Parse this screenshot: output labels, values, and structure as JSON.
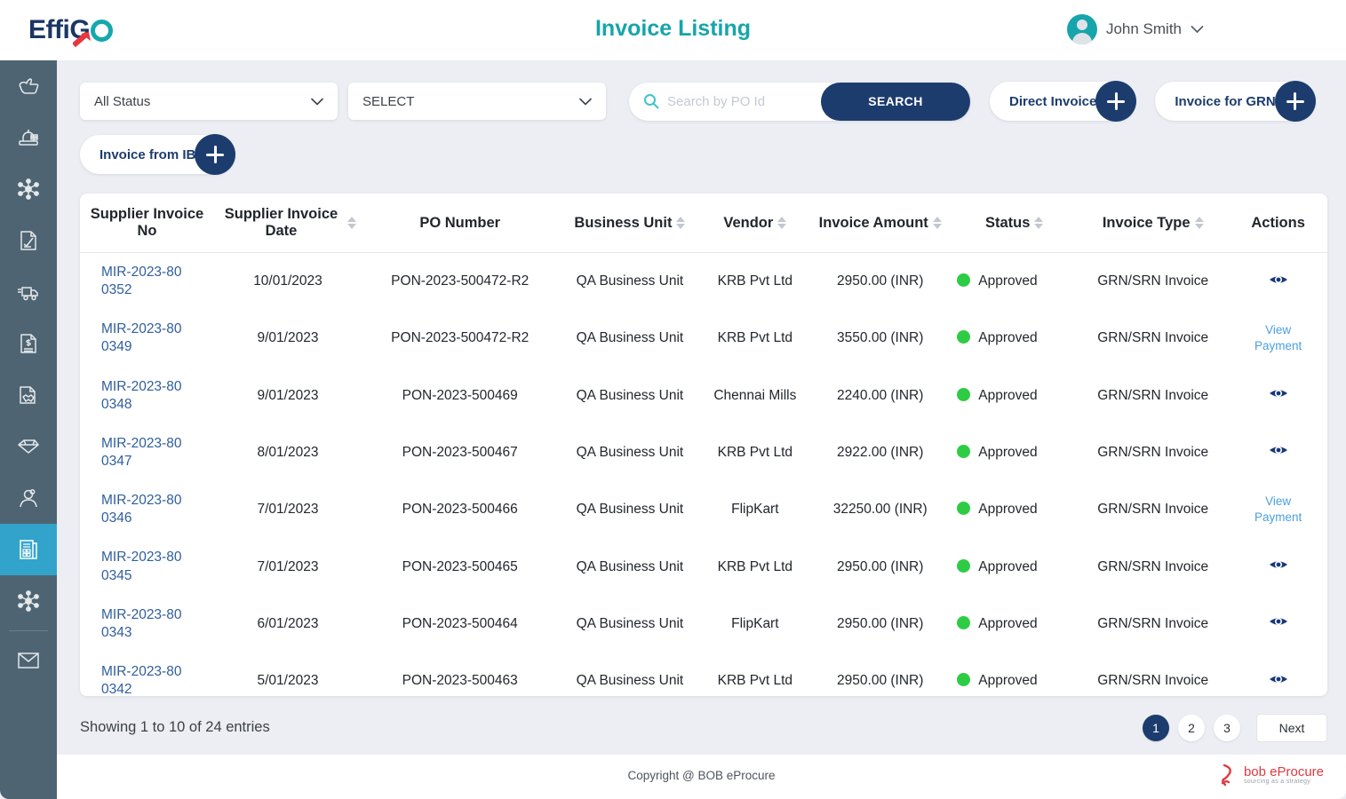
{
  "brand": {
    "logo_text_1": "Effi",
    "logo_text_2": "G",
    "accent_teal": "#16a5ab",
    "accent_navy": "#1d3c6e",
    "accent_red": "#e8363f"
  },
  "header": {
    "title": "Invoice Listing",
    "user_name": "John Smith",
    "caret_icon": "chevron-down-icon",
    "avatar_icon": "user-avatar"
  },
  "sidebar": {
    "items": [
      {
        "icon": "thumbs-up-icon",
        "active": false
      },
      {
        "icon": "auction-gavel-icon",
        "active": false
      },
      {
        "icon": "network-nodes-icon",
        "active": false
      },
      {
        "icon": "document-edit-icon",
        "active": false
      },
      {
        "icon": "delivery-truck-icon",
        "active": false
      },
      {
        "icon": "invoice-dollar-icon",
        "active": false
      },
      {
        "icon": "contract-handshake-icon",
        "active": false
      },
      {
        "icon": "diamond-gem-icon",
        "active": false
      },
      {
        "icon": "user-badge-icon",
        "active": false
      },
      {
        "icon": "invoice-listing-icon",
        "active": true
      },
      {
        "icon": "network-nodes-icon",
        "active": false
      },
      {
        "icon": "envelope-mail-icon",
        "active": false
      }
    ]
  },
  "filters": {
    "status_select": {
      "value": "All Status",
      "icon": "chevron-down-icon"
    },
    "type_select": {
      "value": "SELECT",
      "icon": "chevron-down-icon"
    },
    "search": {
      "placeholder": "Search by PO Id",
      "value": "",
      "icon": "search-icon",
      "button_label": "SEARCH"
    },
    "actions": [
      {
        "label": "Direct Invoice",
        "icon": "plus-icon"
      },
      {
        "label": "Invoice for GRN",
        "icon": "plus-icon"
      },
      {
        "label": "Invoice from IB",
        "icon": "plus-icon"
      }
    ]
  },
  "table": {
    "columns": [
      {
        "label": "Supplier Invoice No",
        "sortable": false
      },
      {
        "label": "Supplier Invoice Date",
        "sortable": true
      },
      {
        "label": "PO Number",
        "sortable": false
      },
      {
        "label": "Business Unit",
        "sortable": true
      },
      {
        "label": "Vendor",
        "sortable": true
      },
      {
        "label": "Invoice Amount",
        "sortable": true
      },
      {
        "label": "Status",
        "sortable": true
      },
      {
        "label": "Invoice Type",
        "sortable": true
      },
      {
        "label": "Actions",
        "sortable": false
      }
    ],
    "rows": [
      {
        "invoice_no": "MIR-2023-800352",
        "date": "10/01/2023",
        "po_number": "PON-2023-500472-R2",
        "business_unit": "QA Business Unit",
        "vendor": "KRB Pvt Ltd",
        "amount": "2950.00 (INR)",
        "status": "Approved",
        "status_color": "#2ecc45",
        "invoice_type": "GRN/SRN Invoice",
        "action": "eye",
        "action_label": ""
      },
      {
        "invoice_no": "MIR-2023-800349",
        "date": "9/01/2023",
        "po_number": "PON-2023-500472-R2",
        "business_unit": "QA Business Unit",
        "vendor": "KRB Pvt Ltd",
        "amount": "3550.00 (INR)",
        "status": "Approved",
        "status_color": "#2ecc45",
        "invoice_type": "GRN/SRN Invoice",
        "action": "link",
        "action_label": "View Payment"
      },
      {
        "invoice_no": "MIR-2023-800348",
        "date": "9/01/2023",
        "po_number": "PON-2023-500469",
        "business_unit": "QA Business Unit",
        "vendor": "Chennai Mills",
        "amount": "2240.00 (INR)",
        "status": "Approved",
        "status_color": "#2ecc45",
        "invoice_type": "GRN/SRN Invoice",
        "action": "eye",
        "action_label": ""
      },
      {
        "invoice_no": "MIR-2023-800347",
        "date": "8/01/2023",
        "po_number": "PON-2023-500467",
        "business_unit": "QA Business Unit",
        "vendor": "KRB Pvt Ltd",
        "amount": "2922.00 (INR)",
        "status": "Approved",
        "status_color": "#2ecc45",
        "invoice_type": "GRN/SRN Invoice",
        "action": "eye",
        "action_label": ""
      },
      {
        "invoice_no": "MIR-2023-800346",
        "date": "7/01/2023",
        "po_number": "PON-2023-500466",
        "business_unit": "QA Business Unit",
        "vendor": "FlipKart",
        "amount": "32250.00 (INR)",
        "status": "Approved",
        "status_color": "#2ecc45",
        "invoice_type": "GRN/SRN Invoice",
        "action": "link",
        "action_label": "View Payment"
      },
      {
        "invoice_no": "MIR-2023-800345",
        "date": "7/01/2023",
        "po_number": "PON-2023-500465",
        "business_unit": "QA Business Unit",
        "vendor": "KRB Pvt Ltd",
        "amount": "2950.00 (INR)",
        "status": "Approved",
        "status_color": "#2ecc45",
        "invoice_type": "GRN/SRN Invoice",
        "action": "eye",
        "action_label": ""
      },
      {
        "invoice_no": "MIR-2023-800343",
        "date": "6/01/2023",
        "po_number": "PON-2023-500464",
        "business_unit": "QA Business Unit",
        "vendor": "FlipKart",
        "amount": "2950.00 (INR)",
        "status": "Approved",
        "status_color": "#2ecc45",
        "invoice_type": "GRN/SRN Invoice",
        "action": "eye",
        "action_label": ""
      },
      {
        "invoice_no": "MIR-2023-800342",
        "date": "5/01/2023",
        "po_number": "PON-2023-500463",
        "business_unit": "QA Business Unit",
        "vendor": "KRB Pvt Ltd",
        "amount": "2950.00 (INR)",
        "status": "Approved",
        "status_color": "#2ecc45",
        "invoice_type": "GRN/SRN Invoice",
        "action": "eye",
        "action_label": ""
      }
    ]
  },
  "pagination": {
    "showing_text": "Showing 1 to 10 of 24 entries",
    "pages": [
      "1",
      "2",
      "3"
    ],
    "active_page": "1",
    "next_label": "Next"
  },
  "footer": {
    "copyright": "Copyright @ BOB eProcure",
    "logo_main": "bob eProcure",
    "logo_sub": "sourcing as a strategy"
  }
}
